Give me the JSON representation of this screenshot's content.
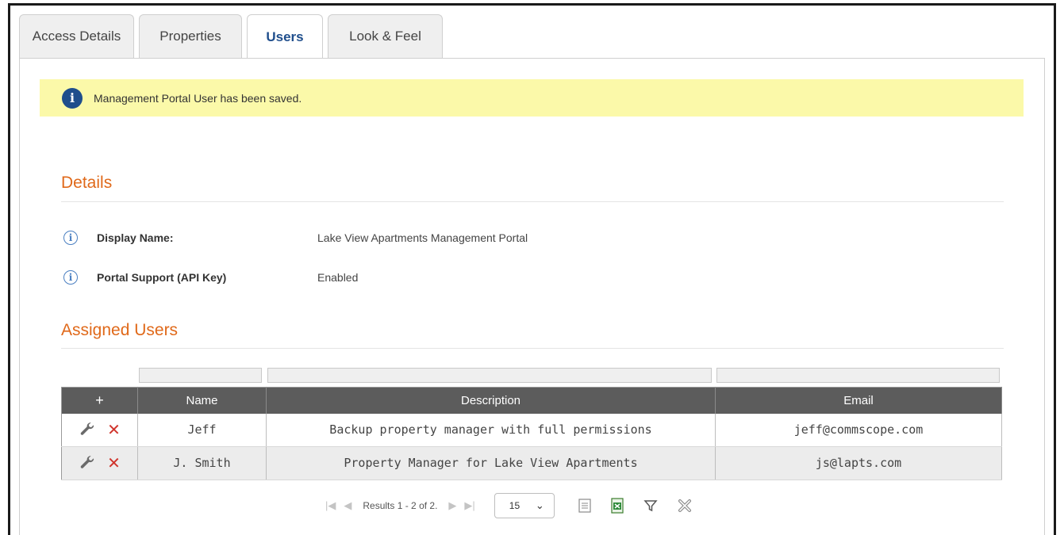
{
  "tabs": [
    {
      "label": "Access Details",
      "active": false
    },
    {
      "label": "Properties",
      "active": false
    },
    {
      "label": "Users",
      "active": true
    },
    {
      "label": "Look & Feel",
      "active": false
    }
  ],
  "alert": {
    "icon": "info-icon",
    "message": "Management Portal User has been saved.",
    "background": "#fbf9a9"
  },
  "details": {
    "title": "Details",
    "fields": [
      {
        "label": "Display Name:",
        "value": "Lake View Apartments Management Portal"
      },
      {
        "label": "Portal Support (API Key)",
        "value": "Enabled"
      }
    ]
  },
  "assigned_users": {
    "title": "Assigned Users",
    "columns": {
      "add": "+",
      "name": "Name",
      "description": "Description",
      "email": "Email"
    },
    "rows": [
      {
        "name": "Jeff",
        "description": "Backup property manager with full permissions",
        "email": "jeff@commscope.com"
      },
      {
        "name": "J. Smith",
        "description": "Property Manager for Lake View Apartments",
        "email": "js@lapts.com"
      }
    ]
  },
  "pager": {
    "results_text": "Results 1 - 2 of 2.",
    "page_size": "15"
  },
  "colors": {
    "accent_orange": "#e0691a",
    "active_tab_blue": "#1f4e8c",
    "header_gray": "#5c5c5c",
    "delete_red": "#d0342c"
  }
}
